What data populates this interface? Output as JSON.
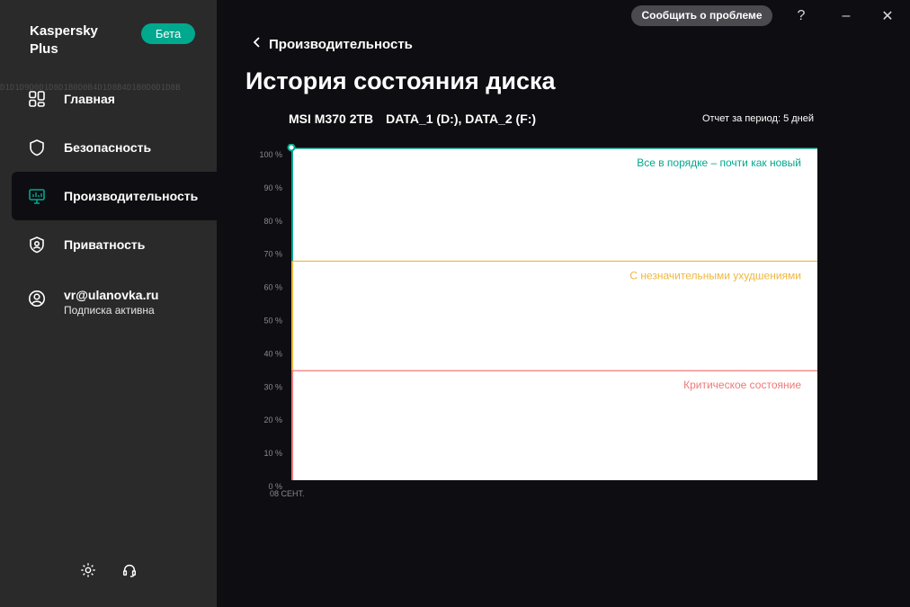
{
  "app": {
    "brand": "Kaspersky Plus",
    "beta_label": "Бета"
  },
  "sidebar": {
    "items": [
      {
        "label": "Главная",
        "icon": "home-grid-icon"
      },
      {
        "label": "Безопасность",
        "icon": "shield-icon"
      },
      {
        "label": "Производительность",
        "icon": "monitor-icon",
        "active": true
      },
      {
        "label": "Приватность",
        "icon": "privacy-shield-icon"
      }
    ],
    "account": {
      "email": "vr@ulanovka.ru",
      "status": "Подписка активна"
    }
  },
  "topbar": {
    "report_label": "Сообщить о проблеме",
    "help_label": "?",
    "minimize_label": "–",
    "close_label": "✕"
  },
  "main": {
    "back_label": "Производительность",
    "title": "История состояния диска",
    "disks": [
      "MSI M370 2TB",
      "DATA_1 (D:), DATA_2 (F:)"
    ],
    "period": "Отчет за период: 5 дней"
  },
  "colors": {
    "good": "#00a88e",
    "warning": "#f0b63c",
    "critical": "#f07878"
  },
  "chart_data": {
    "type": "line",
    "ylim": [
      0,
      100
    ],
    "yticks": [
      "100 %",
      "90 %",
      "80 %",
      "70 %",
      "60 %",
      "50 %",
      "40 %",
      "30 %",
      "20 %",
      "10 %",
      "0 %"
    ],
    "x": [
      "08 СЕНТ."
    ],
    "series": [
      {
        "values": [
          100
        ]
      }
    ],
    "zones": [
      {
        "label": "Все в порядке – почти как новый",
        "from": 66,
        "to": 100,
        "color": "#00a88e"
      },
      {
        "label": "С незначительными ухудшениями",
        "from": 33,
        "to": 66,
        "color": "#f0b63c"
      },
      {
        "label": "Критическое состояние",
        "from": 0,
        "to": 33,
        "color": "#f07878"
      }
    ]
  }
}
